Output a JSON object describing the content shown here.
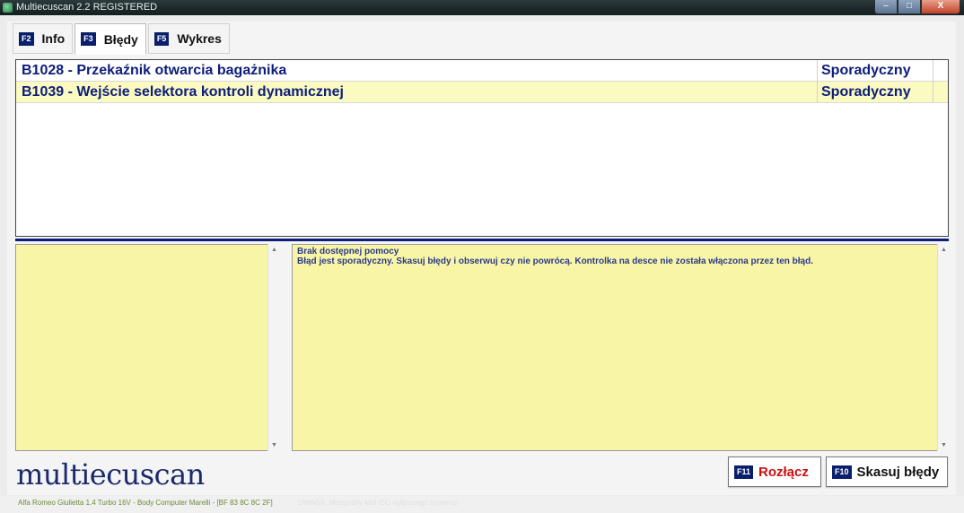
{
  "window": {
    "title": "Multiecuscan 2.2 REGISTERED",
    "min": "–",
    "max": "□",
    "close": "X"
  },
  "tabs": [
    {
      "key": "F2",
      "label": "Info"
    },
    {
      "key": "F3",
      "label": "Błędy"
    },
    {
      "key": "F5",
      "label": "Wykres"
    }
  ],
  "errors": [
    {
      "code": "B1028 - Przekaźnik otwarcia bagażnika",
      "status": "Sporadyczny"
    },
    {
      "code": "B1039 - Wejście selektora kontroli dynamicznej",
      "status": "Sporadyczny"
    }
  ],
  "help": {
    "line1": "Brak dostępnej pomocy",
    "line2": "Błąd jest sporadyczny. Skasuj błędy i obserwuj czy nie powrócą. Kontrolka na desce nie została włączona przez ten błąd."
  },
  "scroll": {
    "up": "▲",
    "down": "▼"
  },
  "logo": "multiecuscan",
  "buttons": {
    "disconnect": {
      "key": "F11",
      "label": "Rozłącz"
    },
    "clear": {
      "key": "F10",
      "label": "Skasuj błędy"
    }
  },
  "status": {
    "vehicle": "Alfa Romeo Giulietta 1.4 Turbo 16V - Body Computer Marelli - [BF 83 8C 8C 2F]",
    "warning": "UWAGA: Niezgodny kod ISO wybranego systemu!"
  }
}
